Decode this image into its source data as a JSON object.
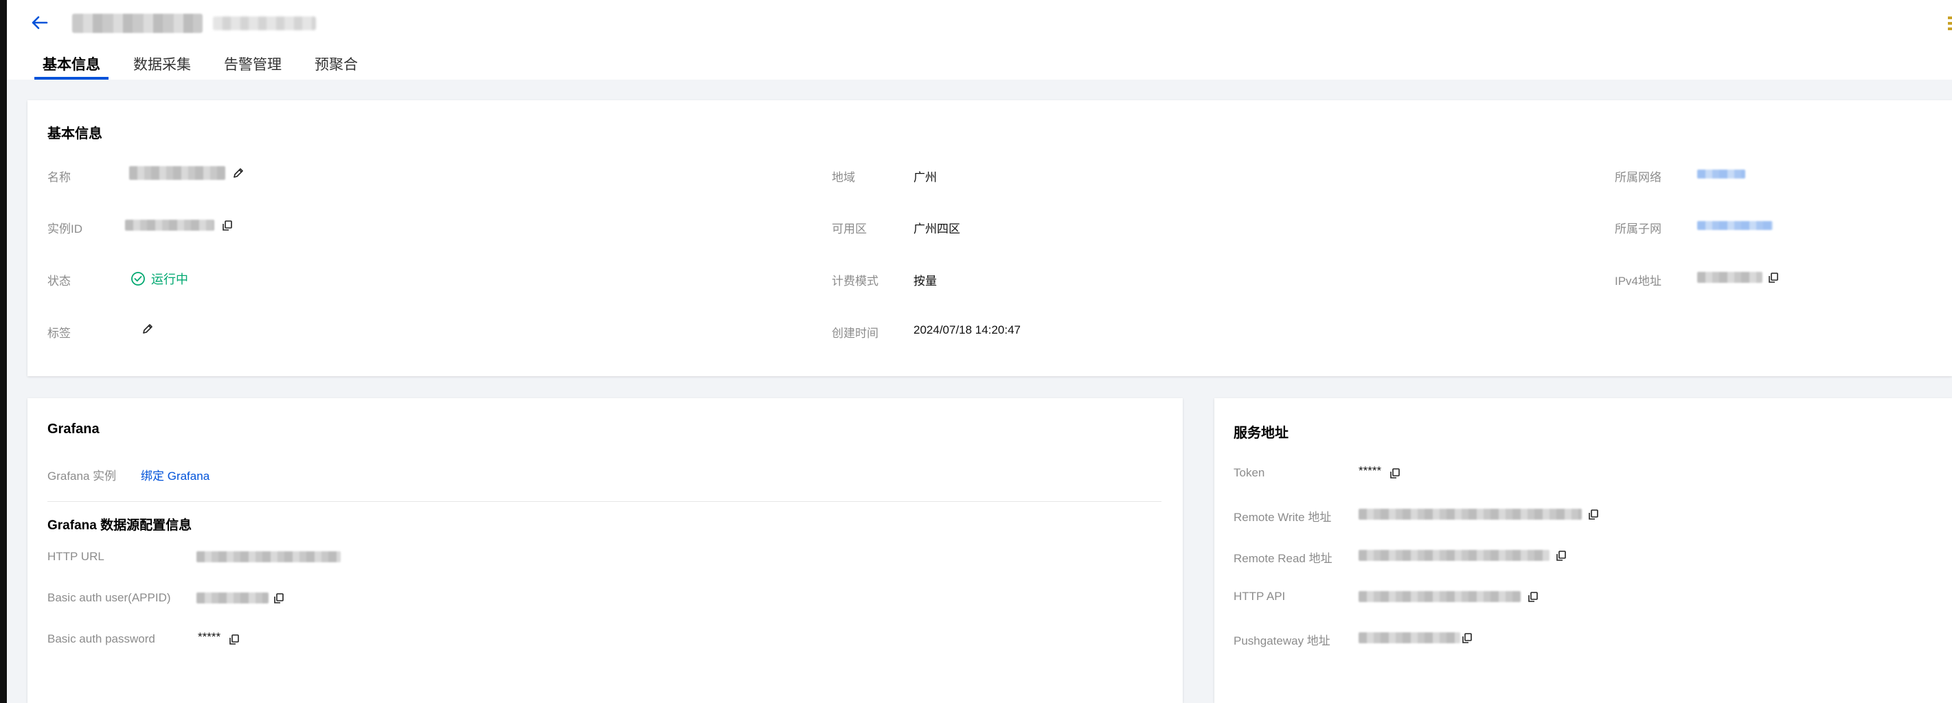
{
  "colors": {
    "accent": "#0052d9",
    "success": "#00a870",
    "label": "#8c8c8c",
    "background": "#f2f4f7"
  },
  "header": {
    "back_icon": "arrow-left-icon"
  },
  "tabs": [
    {
      "label": "基本信息",
      "active": true
    },
    {
      "label": "数据采集",
      "active": false
    },
    {
      "label": "告警管理",
      "active": false
    },
    {
      "label": "预聚合",
      "active": false
    }
  ],
  "basic_info": {
    "title": "基本信息",
    "fields": {
      "name_label": "名称",
      "instance_id_label": "实例ID",
      "status_label": "状态",
      "status_value": "运行中",
      "tag_label": "标签",
      "region_label": "地域",
      "region_value": "广州",
      "zone_label": "可用区",
      "zone_value": "广州四区",
      "billing_label": "计费模式",
      "billing_value": "按量",
      "created_label": "创建时间",
      "created_value": "2024/07/18 14:20:47",
      "vpc_label": "所属网络",
      "subnet_label": "所属子网",
      "ipv4_label": "IPv4地址"
    }
  },
  "grafana": {
    "title": "Grafana",
    "instance_label": "Grafana 实例",
    "bind_link": "绑定 Grafana",
    "datasource_title": "Grafana 数据源配置信息",
    "http_url_label": "HTTP URL",
    "basic_user_label": "Basic auth user(APPID)",
    "basic_password_label": "Basic auth password",
    "basic_password_value": "*****"
  },
  "service_address": {
    "title": "服务地址",
    "token_label": "Token",
    "token_value": "*****",
    "remote_write_label": "Remote Write 地址",
    "remote_read_label": "Remote Read 地址",
    "http_api_label": "HTTP API",
    "pushgateway_label": "Pushgateway 地址"
  }
}
